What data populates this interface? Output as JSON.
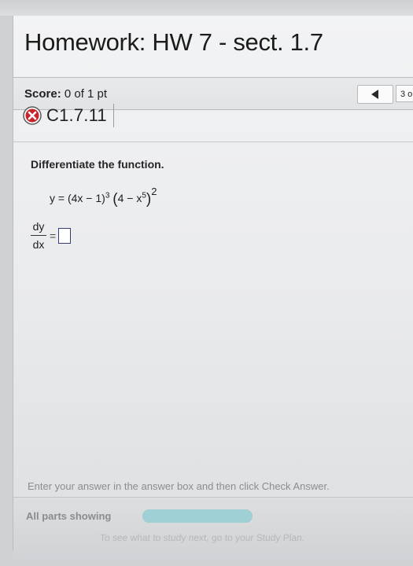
{
  "header": {
    "title": "Homework: HW 7 - sect. 1.7"
  },
  "score": {
    "label": "Score:",
    "value": "0 of 1 pt"
  },
  "nav": {
    "question_number": "3 o",
    "prev_icon": "triangle-left-icon"
  },
  "question": {
    "id": "C1.7.11",
    "status_icon": "incorrect-x-icon",
    "status_color": "#c8252b",
    "prompt": "Differentiate the function.",
    "equation": {
      "lhs": "y = (4x − 1)",
      "exp1": "3",
      "open": "(",
      "inner": "4 − x",
      "exp_inner": "5",
      "close": ")",
      "exp2": "2"
    },
    "derivative": {
      "numerator": "dy",
      "denominator": "dx",
      "equals": "="
    }
  },
  "footer": {
    "instructions": "Enter your answer in the answer box and then click Check Answer.",
    "parts_label": "All parts showing",
    "progress": 1.0,
    "progress_color": "#9fd0d6",
    "study_hint": "To see what to study next, go to your Study Plan."
  }
}
